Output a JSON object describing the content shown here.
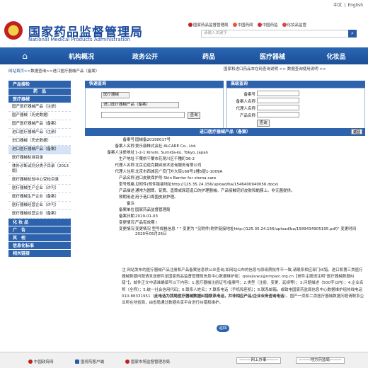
{
  "lang": [
    "中文",
    "English"
  ],
  "site": {
    "title_cn": "国家药品监督管理局",
    "title_en": "National Medical Products Administration"
  },
  "toplinks": [
    "国家药品监督管理局",
    "中国药闻",
    "中国药监",
    "化妆品监管"
  ],
  "search": {
    "placeholder": "请输入关键字"
  },
  "nav": {
    "home_icon": "home-icon",
    "items": [
      "机构概况",
      "政务公开",
      "药品",
      "医疗器械",
      "化妆品"
    ]
  },
  "breadcrumb": {
    "prefix": "网站首页>>",
    "tail": "数据查询>>进口医疗器械产品（备案）",
    "right": "国家和进口药品本在码查询说明 >> 数据查询使用说明 >>"
  },
  "sidebar": {
    "h_prod": "产品搜检",
    "h_drug": "药　品",
    "h_dev": "医疗器械",
    "items": [
      "国产医疗器械产品（注册）",
      "国产器械（历史数据）",
      "国产医疗器械产品（备案）",
      "进口医疗器械产品（注册）",
      "进口器械（历史数据）",
      "进口医疗器械产品（备案）",
      "医疗器械标准目录",
      "体外诊断试剂分类子目录（2013版）",
      "医疗器械检验中心受检目录",
      "医疗器械生产企业（许可）",
      "医疗器械生产企业（备案）",
      "医疗器械经营企业（许可）",
      "医疗器械经营企业（备案）"
    ],
    "h_cos": "化 妆 品",
    "h_ad": "广　告",
    "h_other": "其　他",
    "h_credit": "信息化标准",
    "h_rel": "相关链接"
  },
  "query": {
    "head": "快速查询",
    "select_value": "医疗器械",
    "select2_value": "进口医疗器械产品（备案）",
    "btn": "查询"
  },
  "adv": {
    "head": "高级查询",
    "labels": [
      "备案号",
      "备案人名称",
      "代理人名称",
      "产品名称"
    ],
    "btn": "查询"
  },
  "detail": {
    "head": "进口医疗器械产品（备案）",
    "back_small": "返回",
    "rows": [
      {
        "k": "备案号",
        "v": "国械备20190017号"
      },
      {
        "k": "备案人名称",
        "v": "爱乐康株式会社 ALCARE Co., Ltd."
      },
      {
        "k": "备案人注册地址",
        "v": "1-2-1 Kinshi, Sumida-ku, Tokyo, Japan"
      },
      {
        "k": "生产地址",
        "v": "千葉県千葉市花見川区千種町36-2"
      },
      {
        "k": "代理人名称",
        "v": "北京迈道克翻译技术咨询服务有限公司"
      },
      {
        "k": "代理人住所",
        "v": "北京市西城区广安门外大街168号1幢5层1-1009A"
      },
      {
        "k": "产品名称",
        "v": "进口皮肤保护剂 Skin Barrier for stoma care"
      },
      {
        "k": "型号规格",
        "v": "见附件(附件链接地址http://125.35.24.156/upload/ba/1546400940056.docx)"
      },
      {
        "k": "产品描述",
        "v": "通常为圆筒、锭筒、直筒或尿道造口的护理器械。产品接触完好皮肤和黏膜上。非无菌提供。"
      },
      {
        "k": "预期用途",
        "v": "用于造口周围皮肤护理。"
      },
      {
        "k": "备注",
        "v": ""
      },
      {
        "k": "备案单位",
        "v": "国家药品监督管理局"
      },
      {
        "k": "备案日期",
        "v": "2019-01-03"
      },
      {
        "k": "变更情况",
        "v": "产品有效期 /"
      },
      {
        "k": "变更情况",
        "v": "变更情况 型号规格信息 \" \" 变更为 \"见附件(附件链接地址http://125.35.24.156/upload/ba/1589434905195.pdf)\" 变更时间2020年05月26日"
      }
    ]
  },
  "note": {
    "lead": "注",
    "p1": "网站发布的医疗器械产品注册和产品备案信息供公众查询,如网站公布的信息与原纸质批件不一致,请联系相应部门纠错。进口和第三类医疗器械数据问题请发送邮件至国家药品监督管理局信息中心数据维护组：qixiejiuwu@nmpaic.org.cn【邮件主题请注明“医疗器械数据纠错”】，邮件正文中请准确填写以下内容：1.医疗器械注册证号/备案号；2.类型（注册、变更、延续等）；3.问题描述（500字以内）；4.企业名称（全称）；5.统一社会信用代码；6.联系人姓名；7.联系电话（手机和座机）；8.联系邮箱。或致电国家药监局信息中心数据维护组热线电话010-88331951（",
    "bold": "此电话为我局医疗器械数据纠错联系电话，并非相应产品/企业业务咨询电话",
    "p2": "）。国产一类和二类医疗器械数据问题请联系企业所在地省局，由省局通过数据共享平台进行纠错和维护。"
  },
  "back_btn": "返回",
  "footer": {
    "links": [
      "中国政府网",
      "国务院客户端",
      "国家市场监督管理总局"
    ],
    "sel1": "———网上办事———",
    "sel2": "———地方药监局———"
  }
}
